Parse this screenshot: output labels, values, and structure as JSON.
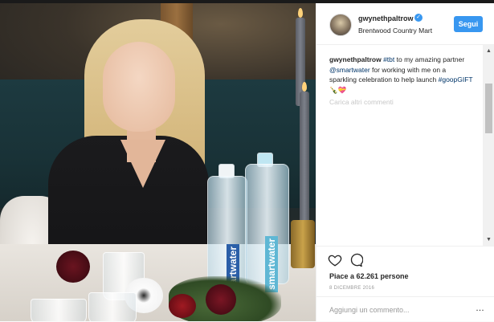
{
  "post": {
    "username": "gwynethpaltrow",
    "verified": true,
    "location": "Brentwood Country Mart",
    "follow_label": "Segui",
    "caption_user": "gwynethpaltrow",
    "caption_hashtag_tbt": "#tbt",
    "caption_text_1": " to my amazing partner ",
    "caption_mention": "@smartwater",
    "caption_text_2": " for working with me on a sparkling celebration to help launch ",
    "caption_hashtag_goop": "#goopGIFT",
    "caption_emoji": " 🍾💝",
    "more_comments": "Carica altri commenti",
    "likes": "Piace a 62.261 persone",
    "date": "8 DICEMBRE 2016",
    "comment_placeholder": "Aggiungi un commento...",
    "more_options": "…"
  },
  "photo": {
    "bottle_label": "smartwater"
  },
  "icons": {
    "like": "heart-icon",
    "comment": "comment-icon",
    "verified": "verified-badge-icon",
    "more": "more-options-icon"
  },
  "colors": {
    "accent": "#3897f0",
    "text": "#262626",
    "muted": "#999999",
    "link": "#003569"
  }
}
